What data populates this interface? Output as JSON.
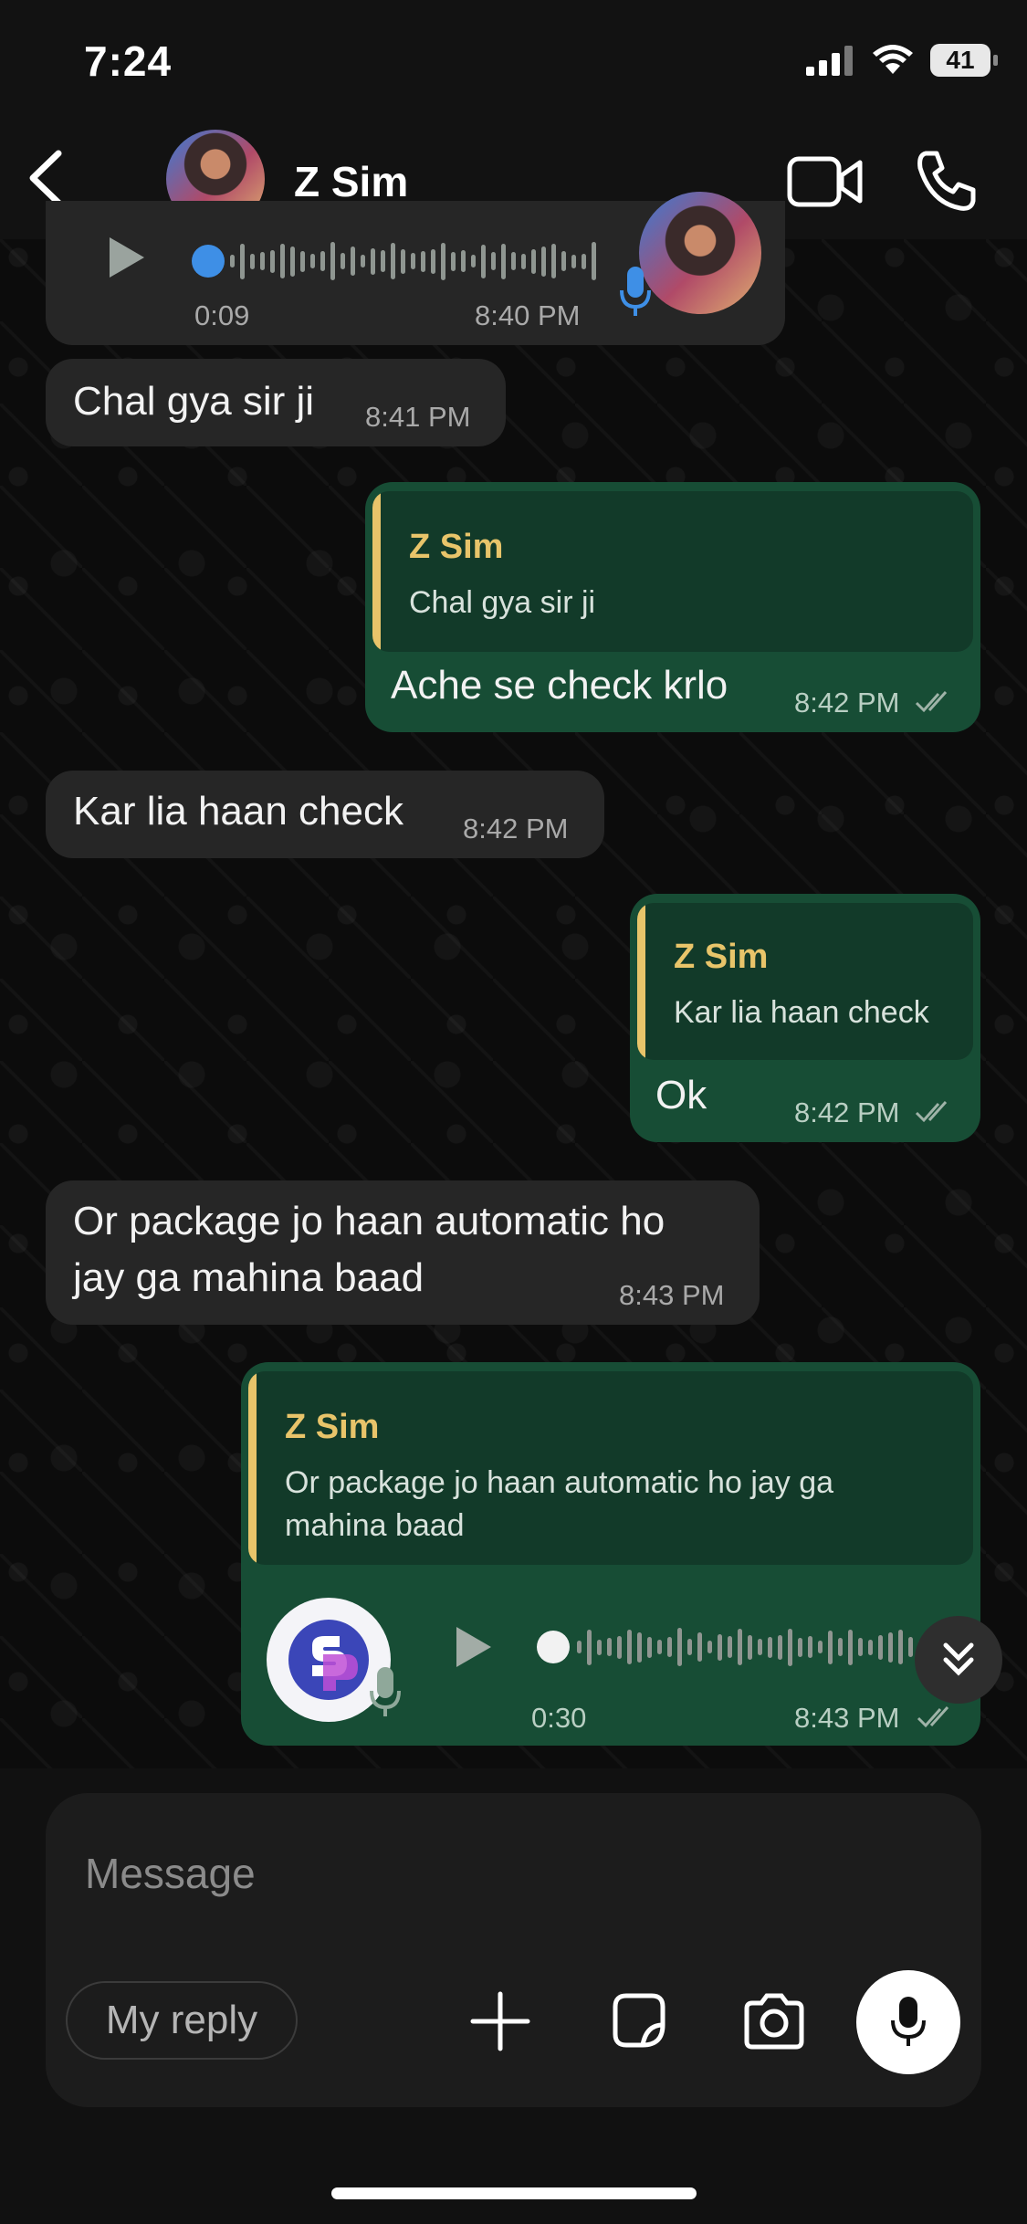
{
  "status_bar": {
    "time": "7:24",
    "battery": "41"
  },
  "header": {
    "contact_name": "Z Sim"
  },
  "messages": [
    {
      "type": "voice",
      "direction": "incoming",
      "duration": "0:09",
      "time": "8:40 PM"
    },
    {
      "type": "text",
      "direction": "incoming",
      "text": "Chal gya sir ji",
      "time": "8:41 PM"
    },
    {
      "type": "reply",
      "direction": "outgoing",
      "quote_name": "Z Sim",
      "quote_text": "Chal gya sir ji",
      "text": "Ache se check krlo",
      "time": "8:42 PM"
    },
    {
      "type": "text",
      "direction": "incoming",
      "text": "Kar lia haan check",
      "time": "8:42 PM"
    },
    {
      "type": "reply",
      "direction": "outgoing",
      "quote_name": "Z Sim",
      "quote_text": "Kar lia haan check",
      "text": "Ok",
      "time": "8:42 PM"
    },
    {
      "type": "text",
      "direction": "incoming",
      "text_line1": "Or package jo haan automatic ho",
      "text_line2": "jay ga mahina baad",
      "time": "8:43 PM"
    },
    {
      "type": "reply-voice",
      "direction": "outgoing",
      "quote_name": "Z Sim",
      "quote_line1": "Or package jo haan automatic ho jay ga",
      "quote_line2": "mahina baad",
      "duration": "0:30",
      "time": "8:43 PM"
    }
  ],
  "composer": {
    "placeholder": "Message",
    "my_reply": "My reply"
  },
  "colors": {
    "outgoing": "#174d35",
    "incoming": "#262626",
    "quote_accent": "#e8c46a"
  }
}
